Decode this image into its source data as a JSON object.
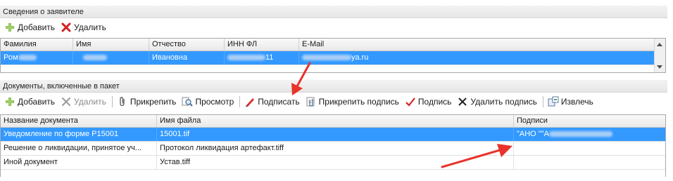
{
  "applicant": {
    "title": "Сведения о заявителе",
    "toolbar": {
      "add": "Добавить",
      "delete": "Удалить"
    },
    "columns": [
      "Фамилия",
      "Имя",
      "Отчество",
      "ИНН ФЛ",
      "E-Mail"
    ],
    "row": {
      "lastname": "Ром",
      "firstname": "",
      "patronymic": "Ивановна",
      "inn_suffix": "11",
      "email_suffix": "ya.ru"
    }
  },
  "documents": {
    "title": "Документы, включенные в пакет",
    "toolbar": {
      "add": "Добавить",
      "delete": "Удалить",
      "attach": "Прикрепить",
      "view": "Просмотр",
      "sign": "Подписать",
      "attach_signature": "Прикрепить подпись",
      "signature": "Подпись",
      "delete_signature": "Удалить подпись",
      "extract": "Извлечь"
    },
    "columns": [
      "Название документа",
      "Имя файла",
      "Подписи"
    ],
    "rows": [
      {
        "name": "Уведомление по форме Р15001",
        "file": "15001.tif",
        "signatures": "\"АНО \"\"А"
      },
      {
        "name": "Решение о ликвидации, принятое уч...",
        "file": "Протокол ликвидация артефакт.tiff",
        "signatures": ""
      },
      {
        "name": "Иной документ",
        "file": "Устав.tiff",
        "signatures": ""
      }
    ]
  },
  "colors": {
    "selection": "#3399ff",
    "annotation_arrow": "#e8332a"
  }
}
